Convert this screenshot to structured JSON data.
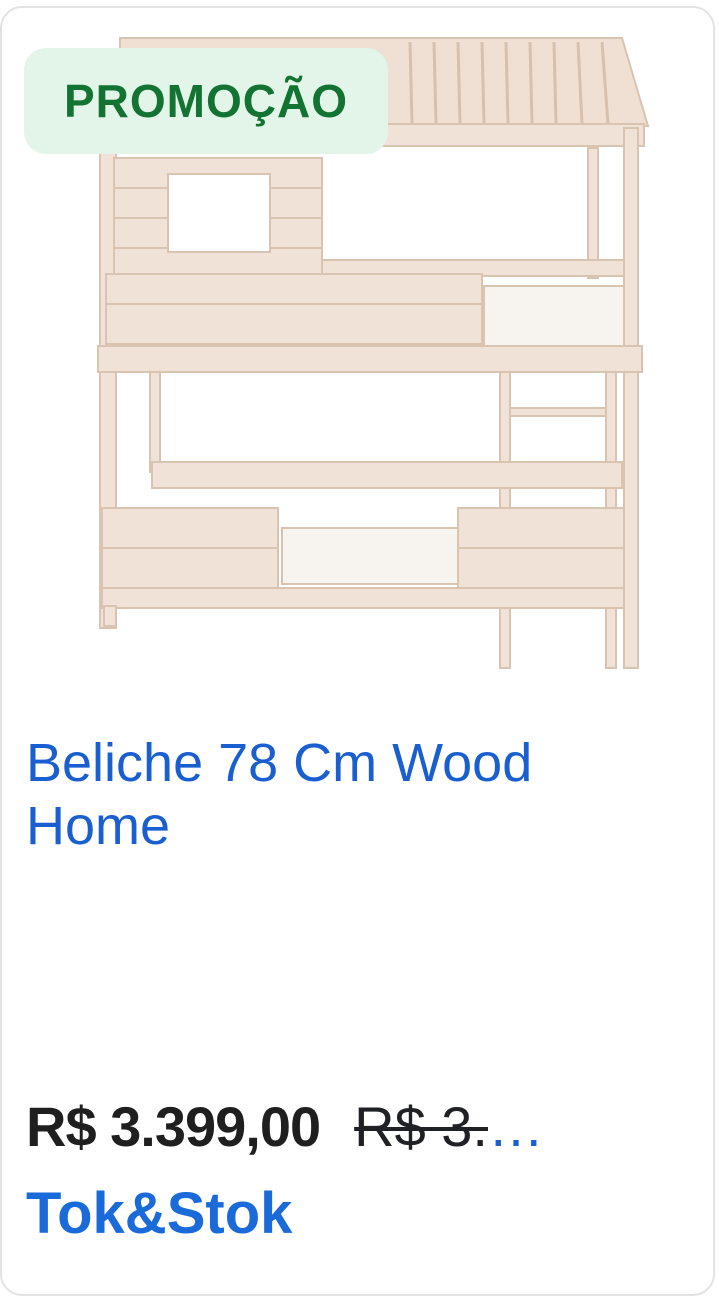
{
  "card": {
    "badge": "PROMOÇÃO",
    "title_line1": "Beliche 78 Cm Wood",
    "title_line2": "Home",
    "price": "R$ 3.399,00",
    "old_price": "R$ 3.",
    "truncation": "…",
    "store": "Tok&Stok"
  },
  "colors": {
    "badge_bg": "#e3f4e8",
    "badge_text": "#137333",
    "link_blue": "#1a5fd0",
    "wood": "#ecdcd0"
  },
  "image": {
    "subject": "wooden bunk bed with house-shaped roof"
  }
}
